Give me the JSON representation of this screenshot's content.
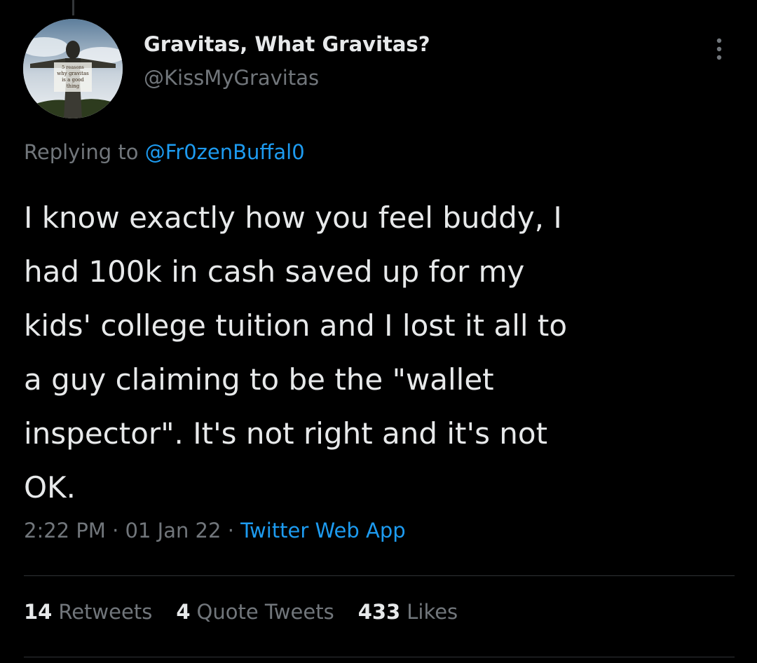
{
  "colors": {
    "background": "#000000",
    "text_primary": "#e7e9ea",
    "text_secondary": "#71767b",
    "link": "#1d9bf0",
    "divider": "#2f3336"
  },
  "author": {
    "display_name": "Gravitas, What Gravitas?",
    "handle": "@KissMyGravitas",
    "avatar_caption": [
      "5 reasons",
      "why gravitas",
      "is a good",
      "thing"
    ]
  },
  "reply": {
    "prefix": "Replying to",
    "mention": "@Fr0zenBuffal0"
  },
  "tweet": {
    "lines": [
      "I know exactly how you feel buddy, I",
      "had 100k in cash saved up for my",
      "kids' college tuition and I lost it all to",
      "a guy claiming to be the \"wallet",
      "inspector\". It's not right and it's not",
      "OK."
    ]
  },
  "meta": {
    "time": "2:22 PM",
    "separator": "·",
    "date": "01 Jan 22",
    "source": "Twitter Web App"
  },
  "stats": {
    "retweets_count": "14",
    "retweets_label": "Retweets",
    "quotes_count": "4",
    "quotes_label": "Quote Tweets",
    "likes_count": "433",
    "likes_label": "Likes"
  },
  "icons": {
    "more": "more-vertical-icon"
  }
}
